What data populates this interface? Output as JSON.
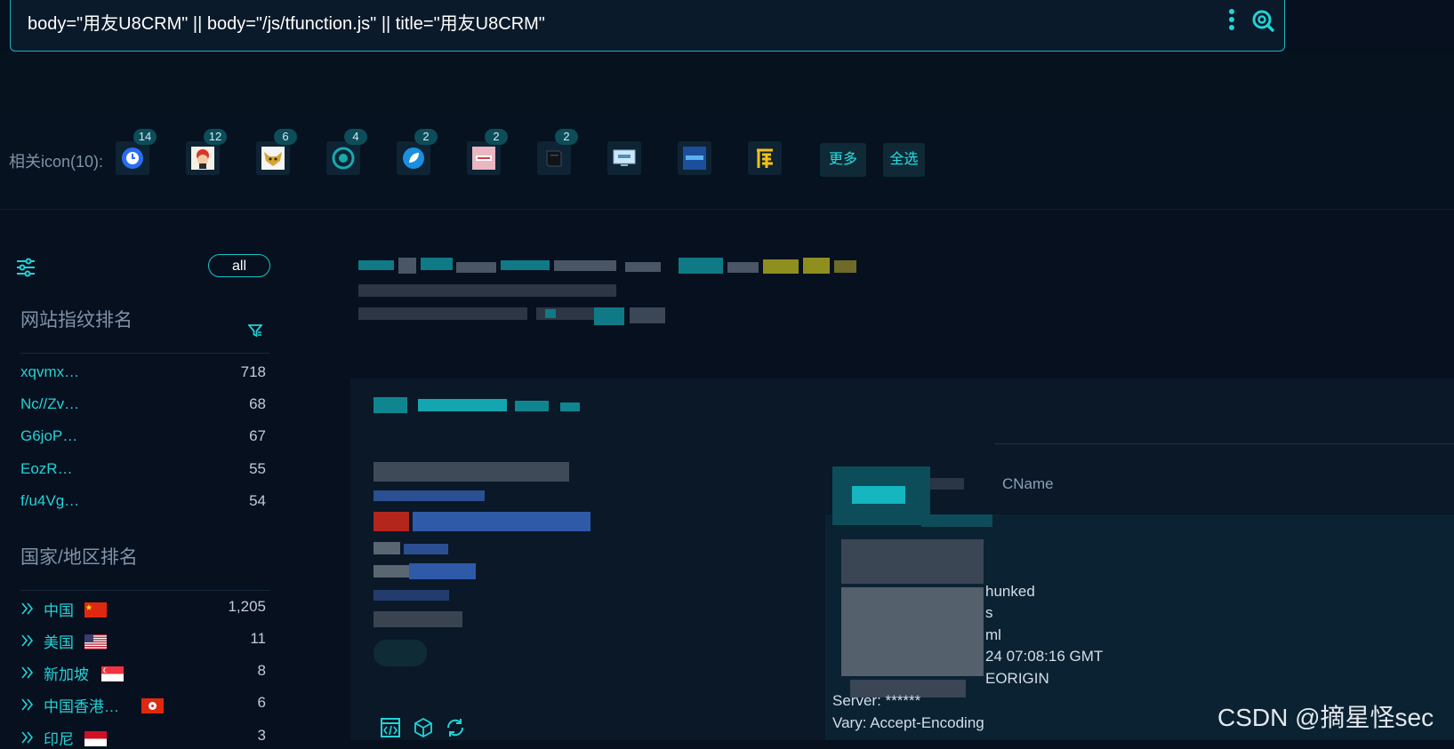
{
  "search": {
    "query": "body=\"用友U8CRM\" || body=\"/js/tfunction.js\" || title=\"用友U8CRM\""
  },
  "icon_bar": {
    "label": "相关icon(10):",
    "icons": [
      {
        "name": "icon-1",
        "count": "14"
      },
      {
        "name": "icon-2",
        "count": "12"
      },
      {
        "name": "icon-3",
        "count": "6"
      },
      {
        "name": "icon-4",
        "count": "4"
      },
      {
        "name": "icon-5",
        "count": "2"
      },
      {
        "name": "icon-6",
        "count": "2"
      },
      {
        "name": "icon-7",
        "count": "2"
      },
      {
        "name": "icon-8",
        "count": ""
      },
      {
        "name": "icon-9",
        "count": ""
      },
      {
        "name": "icon-10",
        "count": ""
      }
    ],
    "more_label": "更多",
    "select_all_label": "全选"
  },
  "sidebar": {
    "all_label": "all",
    "fingerprint_title": "网站指纹排名",
    "fingerprints": [
      {
        "name": "xqvmx…",
        "count": "718"
      },
      {
        "name": "Nc//Zv…",
        "count": "68"
      },
      {
        "name": "G6joP…",
        "count": "67"
      },
      {
        "name": "EozR…",
        "count": "55"
      },
      {
        "name": "f/u4Vg…",
        "count": "54"
      }
    ],
    "country_title": "国家/地区排名",
    "countries": [
      {
        "name": "中国",
        "count": "1,205"
      },
      {
        "name": "美国",
        "count": "11"
      },
      {
        "name": "新加坡",
        "count": "8"
      },
      {
        "name": "中国香港…",
        "count": "6"
      },
      {
        "name": "印尼",
        "count": "3"
      }
    ]
  },
  "result": {
    "tab_cname": "CName",
    "header_lines": [
      "hunked",
      "s",
      "ml",
      "24 07:08:16 GMT",
      "EORIGIN",
      "Server: ******",
      "Vary: Accept-Encoding"
    ]
  },
  "watermark": "CSDN @摘星怪sec",
  "colors": {
    "accent": "#22d3d6",
    "background": "#06101f"
  }
}
